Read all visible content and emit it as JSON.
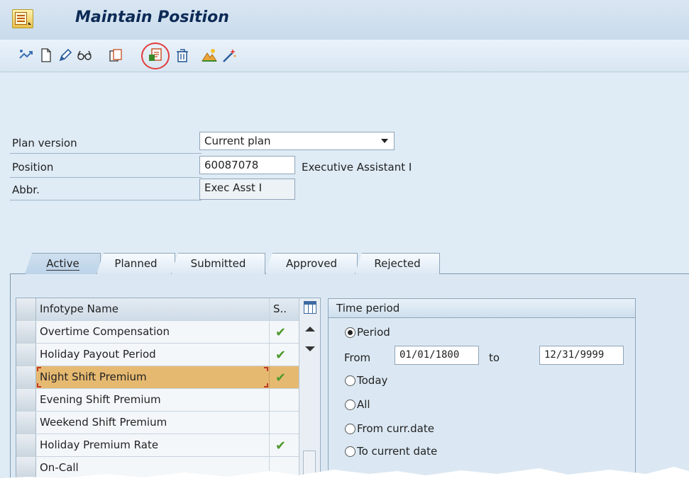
{
  "window": {
    "title": "Maintain Position"
  },
  "toolbar": {
    "icons": [
      "other-object-icon",
      "create-icon",
      "change-icon",
      "display-icon",
      "copy-icon",
      "overview-icon",
      "delete-icon",
      "structure-icon",
      "wizard-icon"
    ]
  },
  "header": {
    "plan_version_label": "Plan version",
    "plan_version_value": "Current plan",
    "position_label": "Position",
    "position_value": "60087078",
    "position_text": "Executive Assistant I",
    "abbr_label": "Abbr.",
    "abbr_value": "Exec Asst I"
  },
  "tabs": [
    {
      "label": "Active",
      "active": true
    },
    {
      "label": "Planned",
      "active": false
    },
    {
      "label": "Submitted",
      "active": false
    },
    {
      "label": "Approved",
      "active": false
    },
    {
      "label": "Rejected",
      "active": false
    }
  ],
  "table": {
    "col_name": "Infotype Name",
    "col_status": "S..",
    "rows": [
      {
        "name": "Overtime Compensation",
        "status": "✔"
      },
      {
        "name": "Holiday Payout Period",
        "status": "✔"
      },
      {
        "name": "Night Shift Premium",
        "status": "✔"
      },
      {
        "name": "Evening Shift Premium",
        "status": ""
      },
      {
        "name": "Weekend Shift Premium",
        "status": ""
      },
      {
        "name": "Holiday Premium Rate",
        "status": "✔"
      },
      {
        "name": "On-Call",
        "status": ""
      }
    ],
    "selected_row": 2
  },
  "time_period": {
    "title": "Time period",
    "period_label": "Period",
    "from_label": "From",
    "from_value": "01/01/1800",
    "to_label": "to",
    "to_value": "12/31/9999",
    "today_label": "Today",
    "all_label": "All",
    "from_curr_label": "From curr.date",
    "to_current_label": "To current date",
    "selected": "Period"
  },
  "colors": {
    "title": "#0c2a55",
    "selected_row": "#e6b971",
    "check": "#4f9a2e",
    "highlight": "#e23b3b"
  }
}
